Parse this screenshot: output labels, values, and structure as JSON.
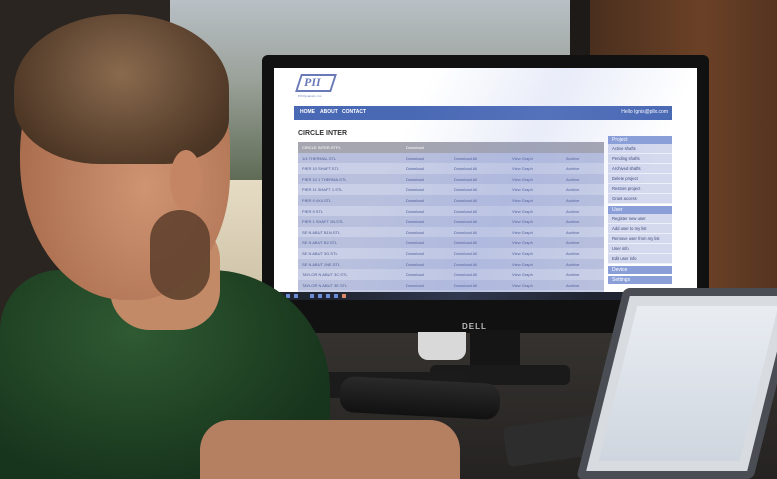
{
  "monitor": {
    "brand": "DELL"
  },
  "logo": {
    "mark": "PII",
    "subtitle": "PII Dynamics, Inc."
  },
  "nav": {
    "items": [
      "HOME",
      "ABOUT",
      "CONTACT"
    ],
    "greeting": "Hello Ignis@pllx.com"
  },
  "page": {
    "title": "CIRCLE INTER"
  },
  "table": {
    "rows": [
      {
        "name": "CIRCLE INTER.STPL",
        "download": "Download",
        "download_all": "",
        "view": "",
        "archive": ""
      },
      {
        "name": "1/4 THERMAL.STL",
        "download": "Download",
        "download_all": "Download All",
        "view": "View Graph",
        "archive": "Archive"
      },
      {
        "name": "PIER 10 SHAFT.STL",
        "download": "Download",
        "download_all": "Download All",
        "view": "View Graph",
        "archive": "Archive"
      },
      {
        "name": "PIER 10 1 THERMA.STL",
        "download": "Download",
        "download_all": "Download All",
        "view": "View Graph",
        "archive": "Archive"
      },
      {
        "name": "PIER 11 SHAFT 1.STL",
        "download": "Download",
        "download_all": "Download All",
        "view": "View Graph",
        "archive": "Archive"
      },
      {
        "name": "PIER 9 4X4.STL",
        "download": "Download",
        "download_all": "Download All",
        "view": "View Graph",
        "archive": "Archive"
      },
      {
        "name": "PIER 9 STL",
        "download": "Download",
        "download_all": "Download All",
        "view": "View Graph",
        "archive": "Archive"
      },
      {
        "name": "PIER 1 SHAFT 1N.STL",
        "download": "Download",
        "download_all": "Download All",
        "view": "View Graph",
        "archive": "Archive"
      },
      {
        "name": "SE N ABUT B1N.STL",
        "download": "Download",
        "download_all": "Download All",
        "view": "View Graph",
        "archive": "Archive"
      },
      {
        "name": "SE N ABUT B2.STL",
        "download": "Download",
        "download_all": "Download All",
        "view": "View Graph",
        "archive": "Archive"
      },
      {
        "name": "SE N ABUT 3G.STL",
        "download": "Download",
        "download_all": "Download All",
        "view": "View Graph",
        "archive": "Archive"
      },
      {
        "name": "SE N ABUT 1NE.STL",
        "download": "Download",
        "download_all": "Download All",
        "view": "View Graph",
        "archive": "Archive"
      },
      {
        "name": "TAYLOR N ABUT 3C.STL",
        "download": "Download",
        "download_all": "Download All",
        "view": "View Graph",
        "archive": "Archive"
      },
      {
        "name": "TAYLOR N ABUT 3E.STL",
        "download": "Download",
        "download_all": "Download All",
        "view": "View Graph",
        "archive": "Archive"
      },
      {
        "name": "TAYLOR N ABUT 3S.STL",
        "download": "Download",
        "download_all": "Download All",
        "view": "View Graph",
        "archive": "Archive"
      },
      {
        "name": "SW PIER 1 SHAFT.STL",
        "download": "Download",
        "download_all": "Download All",
        "view": "View Graph",
        "archive": "Archive"
      }
    ]
  },
  "sidebar": {
    "sections": [
      {
        "heading": "Project",
        "items": [
          "Active shafts",
          "Pending shafts",
          "Archived shafts",
          "Delete project",
          "Restore project",
          "Grant access"
        ]
      },
      {
        "heading": "User",
        "items": [
          "Register new user",
          "Add user to my list",
          "Remove user from my list",
          "User info",
          "Edit user info"
        ]
      },
      {
        "heading": "Device",
        "items": []
      },
      {
        "heading": "Settings",
        "items": []
      }
    ]
  },
  "colors": {
    "navbar": "#4a69b4",
    "row_light": "#c9cfe6",
    "row_dark": "#b9c0de",
    "sidebar_head": "#8a9fd8"
  }
}
